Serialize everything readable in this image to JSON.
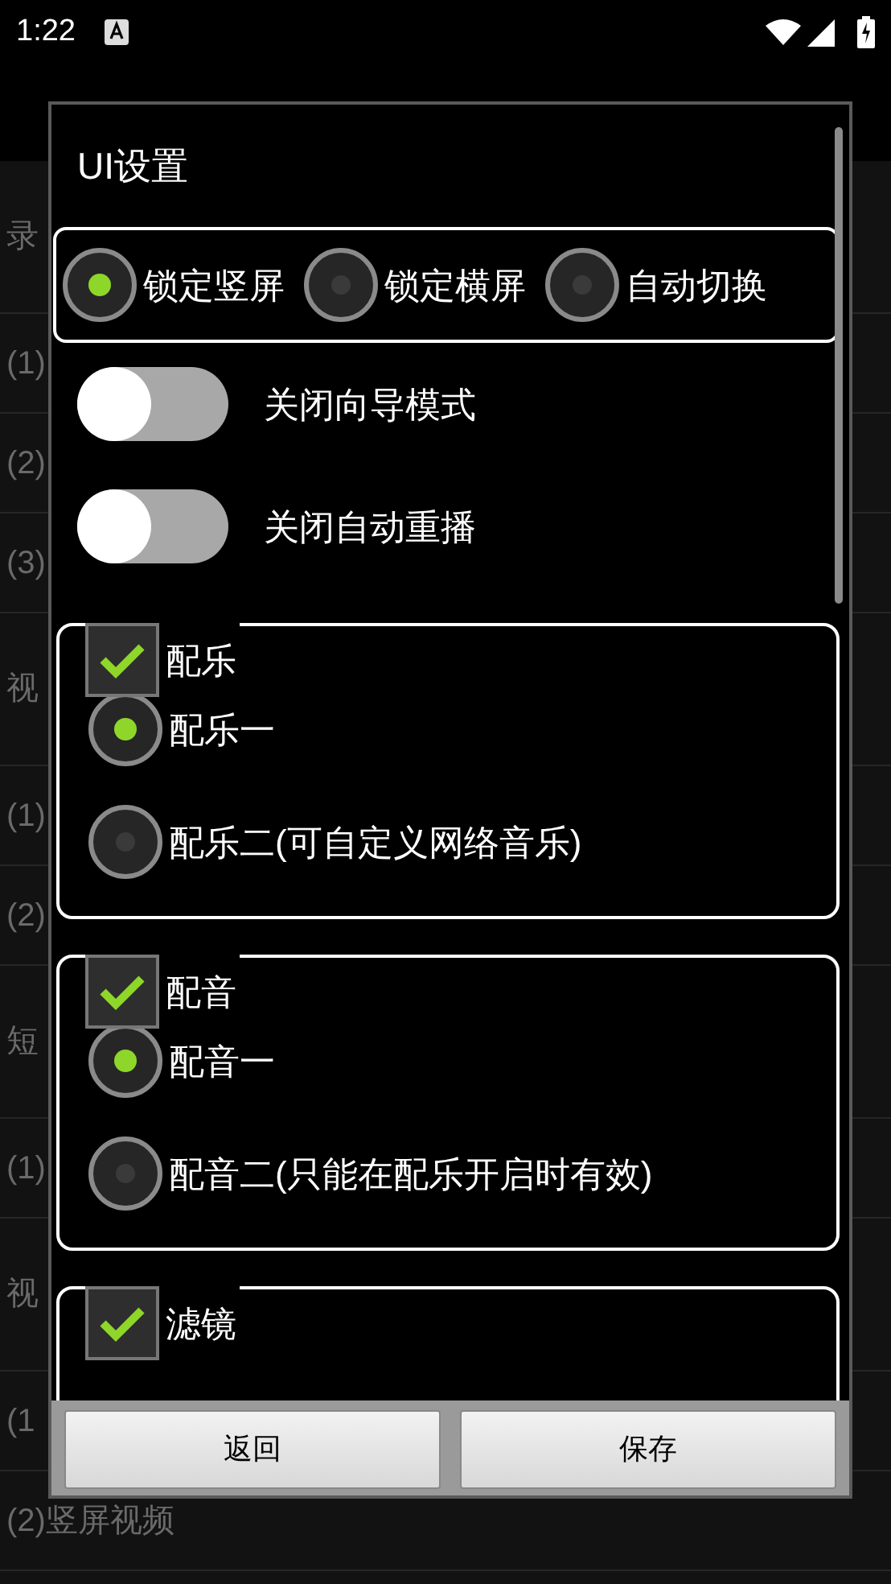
{
  "status_bar": {
    "time": "1:22"
  },
  "background_rows": [
    {
      "kind": "header",
      "text": "录"
    },
    {
      "kind": "item",
      "text": "(1)"
    },
    {
      "kind": "item",
      "text": "(2)"
    },
    {
      "kind": "item",
      "text": "(3)"
    },
    {
      "kind": "header",
      "text": "视"
    },
    {
      "kind": "item",
      "text": "(1)"
    },
    {
      "kind": "item",
      "text": "(2)"
    },
    {
      "kind": "header",
      "text": "短"
    },
    {
      "kind": "item",
      "text": "(1)"
    },
    {
      "kind": "header",
      "text": "视"
    },
    {
      "kind": "item",
      "text": "(1"
    },
    {
      "kind": "item",
      "text": "(2)竖屏视频"
    }
  ],
  "dialog": {
    "title": "UI设置",
    "orientation_options": [
      {
        "label": "锁定竖屏",
        "selected": true
      },
      {
        "label": "锁定横屏",
        "selected": false
      },
      {
        "label": "自动切换",
        "selected": false
      }
    ],
    "toggles": [
      {
        "label": "关闭向导模式",
        "on": false
      },
      {
        "label": "关闭自动重播",
        "on": false
      }
    ],
    "groups": [
      {
        "label": "配乐",
        "checked": true,
        "options": [
          {
            "label": "配乐一",
            "selected": true
          },
          {
            "label": "配乐二(可自定义网络音乐)",
            "selected": false
          }
        ]
      },
      {
        "label": "配音",
        "checked": true,
        "options": [
          {
            "label": "配音一",
            "selected": true
          },
          {
            "label": "配音二(只能在配乐开启时有效)",
            "selected": false
          }
        ]
      },
      {
        "label": "滤镜",
        "checked": true
      }
    ],
    "buttons": [
      "返回",
      "保存"
    ]
  }
}
